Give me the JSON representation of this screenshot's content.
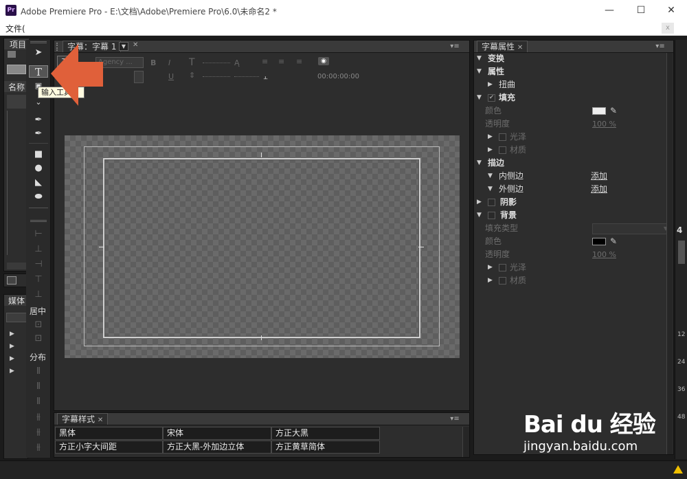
{
  "window": {
    "title": "Adobe Premiere Pro - E:\\文档\\Adobe\\Premiere Pro\\6.0\\未命名2 *",
    "logo": "Pr",
    "minimize": "—",
    "maximize": "☐",
    "close": "✕"
  },
  "menubar": {
    "file": "文件(",
    "close_box": "x"
  },
  "project": {
    "tab": "项目",
    "column": "名称"
  },
  "media": {
    "tab": "媒体"
  },
  "tools": {
    "center_label": "居中",
    "distribute_label": "分布"
  },
  "tooltip": "输入工具",
  "designer": {
    "tab": "字幕：字幕 1",
    "font_name": "Agency ...",
    "timecode": "00:00:00:00"
  },
  "styles": {
    "tab": "字幕样式",
    "rows": [
      [
        "黑体",
        "宋体",
        "方正大黑"
      ],
      [
        "方正小字大间距",
        "方正大黑-外加边立体",
        "方正黄草简体"
      ]
    ]
  },
  "props": {
    "tab": "字幕属性",
    "transform": "变换",
    "attributes": "属性",
    "distort": "扭曲",
    "fill": "填充",
    "fill_color": "颜色",
    "fill_opacity": "透明度",
    "fill_opacity_value": "100 %",
    "sheen": "光泽",
    "texture": "材质",
    "stroke": "描边",
    "inner_stroke": "内侧边",
    "outer_stroke": "外侧边",
    "add": "添加",
    "shadow": "阴影",
    "background": "背景",
    "fill_type": "填充类型",
    "bg_color": "颜色",
    "bg_opacity": "透明度",
    "bg_opacity_value": "100 %",
    "bg_sheen": "光泽",
    "bg_texture": "材质"
  },
  "right_edge": {
    "num1": "4",
    "r12": "12",
    "r24": "24",
    "r36": "36",
    "r48": "48"
  },
  "colors": {
    "fill_color": "#eeeeee",
    "bg_color": "#000000",
    "arrow": "#e0603a"
  },
  "watermark": {
    "brand": "Bai du 经验",
    "url": "jingyan.baidu.com"
  }
}
